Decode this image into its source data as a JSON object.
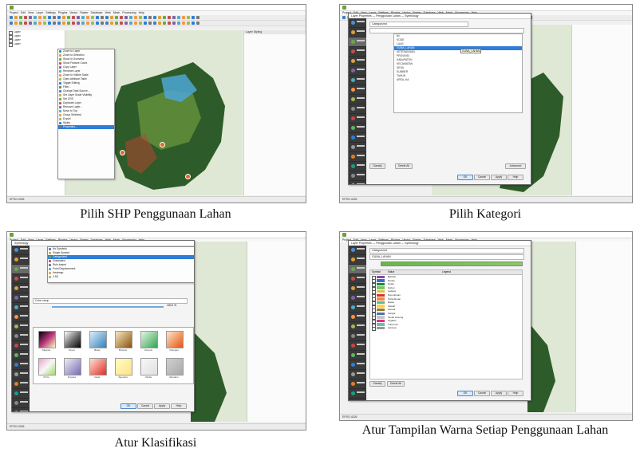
{
  "captions": {
    "panel1": "Pilih SHP Penggunaan Lahan",
    "panel2": "Pilih Kategori",
    "panel3": "Atur Klasifikasi",
    "panel4": "Atur Tampilan Warna Setiap Penggunaan Lahan"
  },
  "qgis": {
    "menu": [
      "Project",
      "Edit",
      "View",
      "Layer",
      "Settings",
      "Plugins",
      "Vector",
      "Raster",
      "Database",
      "Web",
      "Mesh",
      "Processing",
      "Help"
    ],
    "status_render": "Render",
    "status_epsg": "EPSG:4326"
  },
  "panel1": {
    "context_menu": [
      "Zoom to Layer",
      "Zoom to Selection",
      "Show in Overview",
      "Show Feature Count",
      "Copy Layer",
      "Rename Layer",
      "Zoom to Visible Scale",
      "Open Attribute Table",
      "Toggle Editing",
      "Filter...",
      "Change Data Source...",
      "Set Layer Scale Visibility",
      "Set CRS",
      "Duplicate Layer",
      "Remove Layer...",
      "Move to Top",
      "Group Selected",
      "Export",
      "Styles",
      "Properties..."
    ],
    "selected_menu_index": 19
  },
  "panel2": {
    "dialog_title": "Layer Properties — Penggunaan Lahan — Symbology",
    "renderer": "Categorized",
    "value_list": [
      "fid",
      "KODE",
      "LUAS",
      "GUNA_LAHAN",
      "KETERANGAN",
      "PROVINSI",
      "KABUPATEN",
      "KECAMATAN",
      "DESA",
      "SUMBER",
      "TAHUN",
      "AREA_HA"
    ],
    "selected_value_index": 3,
    "tooltip": "GUNA_LAHAN",
    "buttons": {
      "classify": "Classify",
      "delete_all": "Delete All",
      "advanced": "Advanced",
      "ok": "OK",
      "cancel": "Cancel",
      "apply": "Apply",
      "help": "Help"
    }
  },
  "panel3": {
    "renderer_menu": [
      "No Symbols",
      "Single Symbol",
      "Categorized",
      "Graduated",
      "Rule-based",
      "Point Displacement",
      "Heatmap",
      "2.5D"
    ],
    "selected_renderer_index": 2,
    "ramp_label": "Color ramp",
    "ramps": [
      "Magma",
      "Greys",
      "Blues",
      "Browns",
      "Greens",
      "Oranges",
      "PiYG",
      "Purples",
      "Reds",
      "Spectral",
      "Viridis",
      "Random"
    ],
    "opacity": "100.0 %",
    "buttons": {
      "ok": "OK",
      "cancel": "Cancel",
      "apply": "Apply",
      "help": "Help"
    }
  },
  "panel4": {
    "dialog_title": "Layer Properties — Penggunaan Lahan — Symbology",
    "renderer": "Categorized",
    "value_field": "GUNA_LAHAN",
    "table_header": [
      "Symbol",
      "Value",
      "Legend"
    ],
    "categories": [
      {
        "value": "Belukar",
        "color": "#8e44ad"
      },
      {
        "value": "Danau",
        "color": "#2f6fd6"
      },
      {
        "value": "Hutan",
        "color": "#1e8a3c"
      },
      {
        "value": "Kebun",
        "color": "#7cc46a"
      },
      {
        "value": "Ladang",
        "color": "#d9c64a"
      },
      {
        "value": "Pemukiman",
        "color": "#d73027"
      },
      {
        "value": "Perkebunan",
        "color": "#f08a3c"
      },
      {
        "value": "Rawa",
        "color": "#5ab4ac"
      },
      {
        "value": "Sawah",
        "color": "#ffd23f"
      },
      {
        "value": "Semak",
        "color": "#a6761d"
      },
      {
        "value": "Sungai",
        "color": "#4575b4"
      },
      {
        "value": "Tanah Kosong",
        "color": "#c7c7c7"
      },
      {
        "value": "Tegalan",
        "color": "#e7298a"
      },
      {
        "value": "Tubuh Air",
        "color": "#66c2a5"
      },
      {
        "value": "Lainnya",
        "color": "#999999"
      }
    ],
    "buttons": {
      "classify": "Classify",
      "delete_all": "Delete All",
      "ok": "OK",
      "cancel": "Cancel",
      "apply": "Apply",
      "help": "Help"
    }
  },
  "colors": {
    "accent": "#2f7dd7",
    "sidebar_dark": "#3a3a3a",
    "map_bg": "#dfe8d4",
    "terrain": "#2e5e2a"
  }
}
